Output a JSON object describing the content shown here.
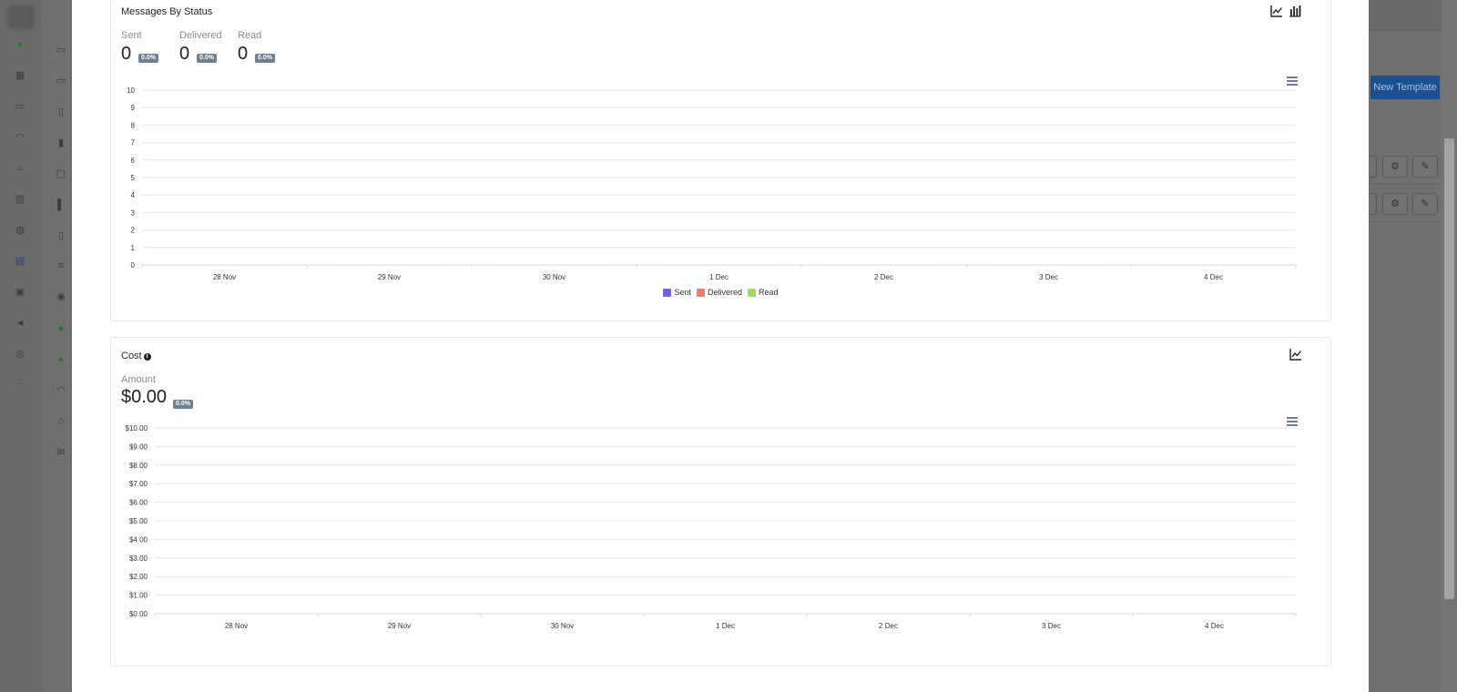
{
  "background": {
    "new_template_label": "New Template",
    "rail_icons": [
      "chat-icon",
      "grid-icon",
      "presentation-icon",
      "headset-icon",
      "user-icon",
      "layout-icon",
      "globe-icon",
      "template-icon",
      "archive-icon",
      "megaphone-icon",
      "support-icon",
      "help-icon"
    ],
    "sub_icons": [
      "card-icon",
      "card-icon",
      "bag-icon",
      "bookmark-icon",
      "share-icon",
      "bar-chart-icon",
      "clipboard-icon",
      "list-icon",
      "account-icon",
      "whatsapp-icon",
      "whatsapp-icon",
      "bell-icon",
      "star-icon",
      "mail-icon"
    ],
    "row_action_icons": [
      "gears-icon",
      "pencil-icon"
    ]
  },
  "messages_by_status": {
    "title": "Messages By Status",
    "metrics": [
      {
        "label": "Sent",
        "value": "0",
        "badge": "0.0%"
      },
      {
        "label": "Delivered",
        "value": "0",
        "badge": "0.0%"
      },
      {
        "label": "Read",
        "value": "0",
        "badge": "0.0%"
      }
    ],
    "tool_icons": [
      "line-chart-icon",
      "bar-chart-icon"
    ],
    "menu_icon": "hamburger-menu-icon"
  },
  "cost": {
    "title": "Cost",
    "info_icon": "info-icon",
    "tool_icons": [
      "line-chart-icon"
    ],
    "metric": {
      "label": "Amount",
      "value": "$0.00",
      "badge": "0.0%"
    },
    "menu_icon": "hamburger-menu-icon"
  },
  "chart_data": [
    {
      "type": "line",
      "x": [
        "28 Nov",
        "29 Nov",
        "30 Nov",
        "1 Dec",
        "2 Dec",
        "3 Dec",
        "4 Dec"
      ],
      "yticks": [
        "0",
        "1",
        "2",
        "3",
        "4",
        "5",
        "6",
        "7",
        "8",
        "9",
        "10"
      ],
      "ylim": [
        0,
        10
      ],
      "grid": true,
      "legend": "bottom",
      "series": [
        {
          "name": "Sent",
          "color": "#7060ee",
          "values": [
            0,
            0,
            0,
            0,
            0,
            0,
            0
          ]
        },
        {
          "name": "Delivered",
          "color": "#f07a6c",
          "values": [
            0,
            0,
            0,
            0,
            0,
            0,
            0
          ]
        },
        {
          "name": "Read",
          "color": "#a3d95b",
          "values": [
            0,
            0,
            0,
            0,
            0,
            0,
            0
          ]
        }
      ]
    },
    {
      "type": "line",
      "x": [
        "28 Nov",
        "29 Nov",
        "30 Nov",
        "1 Dec",
        "2 Dec",
        "3 Dec",
        "4 Dec"
      ],
      "yticks": [
        "$0.00",
        "$1.00",
        "$2.00",
        "$3.00",
        "$4.00",
        "$5.00",
        "$6.00",
        "$7.00",
        "$8.00",
        "$9.00",
        "$10.00"
      ],
      "ylim": [
        0,
        10
      ],
      "grid": true,
      "series": [
        {
          "color": "#7060ee",
          "values": [
            0,
            0,
            0,
            0,
            0,
            0,
            0
          ]
        }
      ]
    }
  ]
}
